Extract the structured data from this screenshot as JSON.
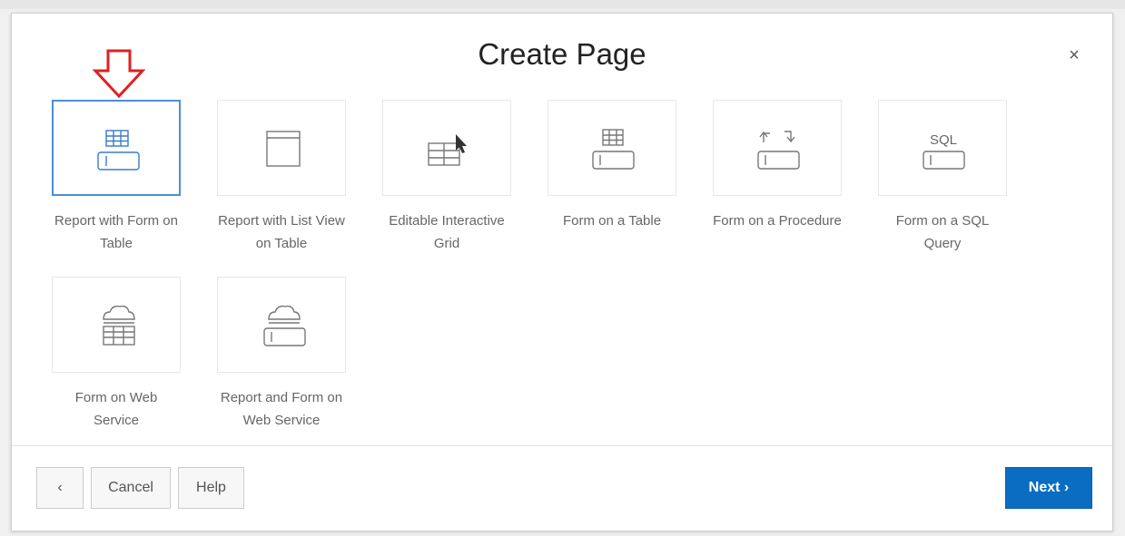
{
  "dialog": {
    "title": "Create Page",
    "close_label": "×"
  },
  "tiles": [
    {
      "label_line1": "Report with Form on",
      "label_line2": "Table",
      "icon": "report-with-form-icon",
      "selected": true
    },
    {
      "label_line1": "Report with List View",
      "label_line2": "on Table",
      "icon": "list-view-icon",
      "selected": false
    },
    {
      "label_line1": "Editable Interactive",
      "label_line2": "Grid",
      "icon": "interactive-grid-icon",
      "selected": false
    },
    {
      "label_line1": "Form on a Table",
      "label_line2": "",
      "icon": "form-table-icon",
      "selected": false
    },
    {
      "label_line1": "Form on a Procedure",
      "label_line2": "",
      "icon": "form-procedure-icon",
      "selected": false
    },
    {
      "label_line1": "Form on a SQL",
      "label_line2": "Query",
      "icon": "form-sql-icon",
      "icon_text": "SQL",
      "selected": false
    },
    {
      "label_line1": "Form on Web",
      "label_line2": "Service",
      "icon": "form-web-service-icon",
      "selected": false
    },
    {
      "label_line1": "Report and Form on",
      "label_line2": "Web Service",
      "icon": "report-form-web-service-icon",
      "selected": false
    }
  ],
  "footer": {
    "back_label": "‹",
    "cancel_label": "Cancel",
    "help_label": "Help",
    "next_label": "Next ›"
  },
  "colors": {
    "selected_border": "#4a8fd6",
    "next_button": "#0a6dc2",
    "arrow": "#e02020"
  }
}
